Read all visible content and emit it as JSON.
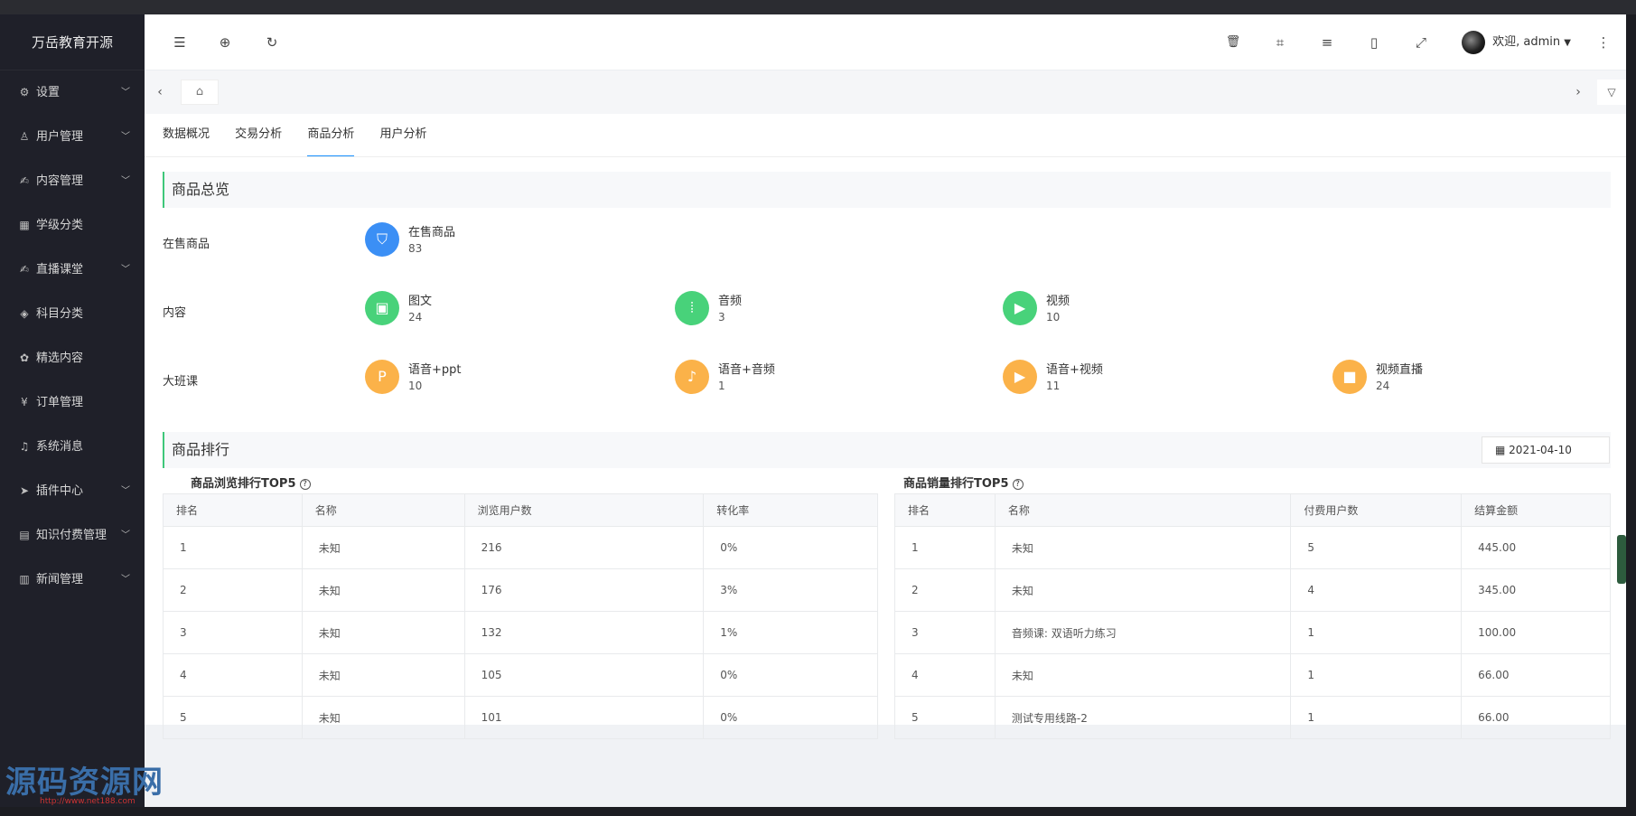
{
  "brand": "万岳教育开源",
  "sidebar": {
    "items": [
      {
        "label": "设置",
        "icon": "⚙",
        "chevron": true
      },
      {
        "label": "用户管理",
        "icon": "♙",
        "chevron": true
      },
      {
        "label": "内容管理",
        "icon": "✍",
        "chevron": true
      },
      {
        "label": "学级分类",
        "icon": "▦",
        "chevron": false
      },
      {
        "label": "直播课堂",
        "icon": "✍",
        "chevron": true
      },
      {
        "label": "科目分类",
        "icon": "◈",
        "chevron": false
      },
      {
        "label": "精选内容",
        "icon": "✿",
        "chevron": false
      },
      {
        "label": "订单管理",
        "icon": "¥",
        "chevron": false
      },
      {
        "label": "系统消息",
        "icon": "♫",
        "chevron": false
      },
      {
        "label": "插件中心",
        "icon": "➤",
        "chevron": true
      },
      {
        "label": "知识付费管理",
        "icon": "▤",
        "chevron": true
      },
      {
        "label": "新闻管理",
        "icon": "▥",
        "chevron": true
      }
    ]
  },
  "header": {
    "user_label": "欢迎, admin"
  },
  "tabs": [
    "数据概况",
    "交易分析",
    "商品分析",
    "用户分析"
  ],
  "overview": {
    "title": "商品总览",
    "rows": [
      {
        "label": "在售商品",
        "stats": [
          {
            "label": "在售商品",
            "value": "83",
            "color": "blue",
            "icon": "tag-icon"
          }
        ]
      },
      {
        "label": "内容",
        "stats": [
          {
            "label": "图文",
            "value": "24",
            "color": "green",
            "icon": "image-icon"
          },
          {
            "label": "音频",
            "value": "3",
            "color": "green",
            "icon": "audio-wave-icon"
          },
          {
            "label": "视频",
            "value": "10",
            "color": "green",
            "icon": "play-icon"
          }
        ]
      },
      {
        "label": "大班课",
        "stats": [
          {
            "label": "语音+ppt",
            "value": "10",
            "color": "orange",
            "icon": "ppt-icon"
          },
          {
            "label": "语音+音频",
            "value": "1",
            "color": "orange",
            "icon": "microphone-icon"
          },
          {
            "label": "语音+视频",
            "value": "11",
            "color": "orange",
            "icon": "play-icon"
          },
          {
            "label": "视频直播",
            "value": "24",
            "color": "orange",
            "icon": "camera-icon"
          }
        ]
      }
    ]
  },
  "ranking": {
    "title": "商品排行",
    "date": "2021-04-10",
    "browse": {
      "title": "商品浏览排行TOP5",
      "headers": [
        "排名",
        "名称",
        "浏览用户数",
        "转化率"
      ],
      "rows": [
        [
          "1",
          "未知",
          "216",
          "0%"
        ],
        [
          "2",
          "未知",
          "176",
          "3%"
        ],
        [
          "3",
          "未知",
          "132",
          "1%"
        ],
        [
          "4",
          "未知",
          "105",
          "0%"
        ],
        [
          "5",
          "未知",
          "101",
          "0%"
        ]
      ]
    },
    "sales": {
      "title": "商品销量排行TOP5",
      "headers": [
        "排名",
        "名称",
        "付费用户数",
        "结算金额"
      ],
      "rows": [
        [
          "1",
          "未知",
          "5",
          "445.00"
        ],
        [
          "2",
          "未知",
          "4",
          "345.00"
        ],
        [
          "3",
          "音频课: 双语听力练习",
          "1",
          "100.00"
        ],
        [
          "4",
          "未知",
          "1",
          "66.00"
        ],
        [
          "5",
          "测试专用线路-2",
          "1",
          "66.00"
        ]
      ]
    }
  },
  "watermark": {
    "text": "源码资源网",
    "sub": "http://www.net188.com"
  },
  "colors": {
    "blue": "#3b8ff5",
    "green": "#48d27a",
    "orange": "#fbb249",
    "accent": "#1890ff",
    "sidebar_bg": "#1f2029"
  }
}
